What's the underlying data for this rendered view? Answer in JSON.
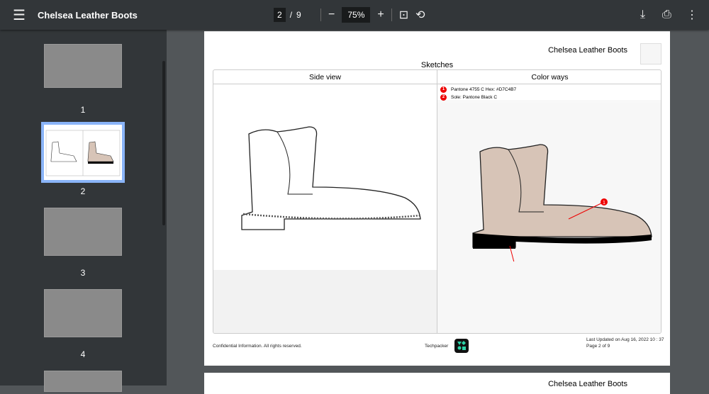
{
  "toolbar": {
    "title": "Chelsea Leather Boots",
    "current_page": "2",
    "separator": "/",
    "total_pages": "9",
    "zoom": "75%"
  },
  "sidebar": {
    "thumbnails": [
      {
        "label": "1"
      },
      {
        "label": "2",
        "selected": true
      },
      {
        "label": "3"
      },
      {
        "label": "4"
      }
    ]
  },
  "page": {
    "header_title": "Chelsea Leather Boots",
    "section_title": "Sketches",
    "side_view": {
      "header": "Side view"
    },
    "color_ways": {
      "header": "Color ways",
      "items": [
        {
          "num": "1",
          "text": "Pantone 4755 C Hex: #D7C4B7"
        },
        {
          "num": "2",
          "text": "Sole: Pantone Black C"
        }
      ],
      "leather_color": "#D7C4B7",
      "sole_color": "#000000"
    },
    "footer": {
      "confidential": "Confidential Information. All rights reserved.",
      "brand": "Techpacker",
      "updated": "Last Updated on Aug 16, 2022 10 : 37",
      "page_of": "Page 2 of 9"
    }
  },
  "next_page": {
    "header_title": "Chelsea Leather Boots"
  }
}
